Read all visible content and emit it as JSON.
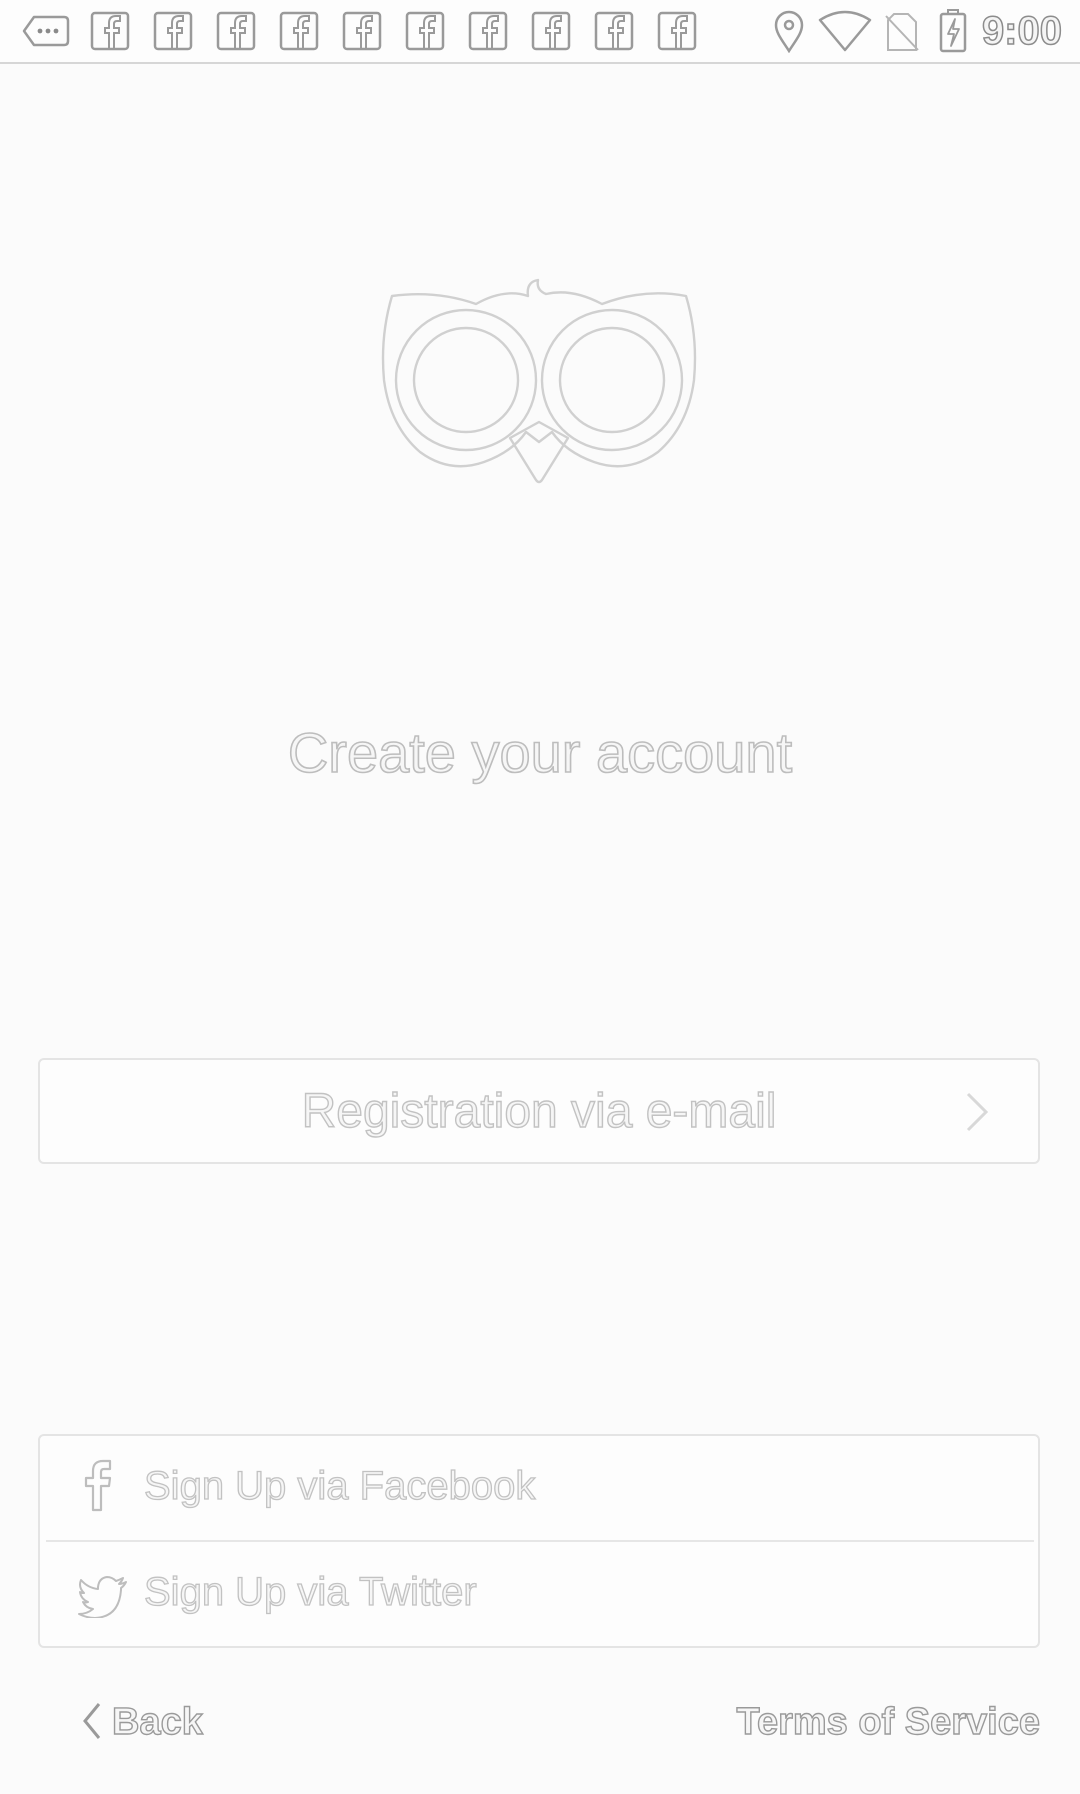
{
  "status_bar": {
    "time": "9:00",
    "notification_icons": [
      "more-notifications-icon",
      "facebook-icon",
      "facebook-icon",
      "facebook-icon",
      "facebook-icon",
      "facebook-icon",
      "facebook-icon",
      "facebook-icon",
      "facebook-icon",
      "facebook-icon",
      "facebook-icon"
    ],
    "system_icons": [
      "location-icon",
      "wifi-icon",
      "no-sim-icon",
      "battery-charging-icon"
    ]
  },
  "logo": {
    "icon": "owl-logo-icon"
  },
  "main": {
    "title": "Create your account",
    "email_button_label": "Registration via e-mail",
    "email_button_icon": "chevron-right-icon"
  },
  "social": {
    "facebook_label": "Sign Up via Facebook",
    "facebook_icon": "facebook-icon",
    "twitter_label": "Sign Up via Twitter",
    "twitter_icon": "twitter-icon"
  },
  "footer": {
    "back_label": "Back",
    "back_icon": "chevron-left-icon",
    "terms_label": "Terms of Service"
  },
  "colors": {
    "background": "#fbfbfb",
    "outline": "#bdbdbd",
    "border": "#e4e4e4"
  }
}
